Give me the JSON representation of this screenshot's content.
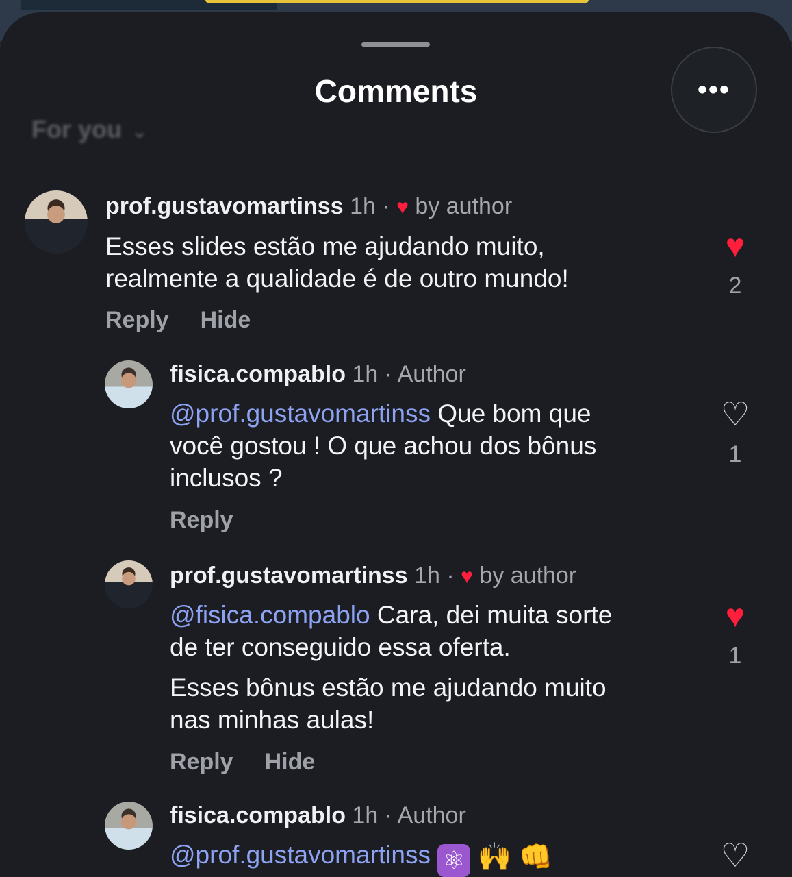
{
  "header": {
    "title": "Comments",
    "more_label": "•••",
    "filter_label": "For you",
    "filter_chevron": "⌄"
  },
  "comments": [
    {
      "username": "prof.gustavomartinss",
      "time": "1h",
      "sep": "·",
      "badge_heart": "♥",
      "badge": "by author",
      "text_lines": [
        "Esses slides estão me ajudando muito,",
        "realmente a qualidade é de outro mundo!"
      ],
      "like_icon": "♥",
      "likes": "2",
      "liked": true,
      "actions": [
        "Reply",
        "Hide"
      ]
    },
    {
      "username": "fisica.compablo",
      "time": "1h",
      "sep": "·",
      "badge": "Author",
      "mention": "@prof.gustavomartinss",
      "text_a": "Que bom que",
      "text_lines": [
        "você gostou ! O que achou dos bônus",
        "inclusos ?"
      ],
      "like_icon": "♡",
      "likes": "1",
      "liked": false,
      "actions": [
        "Reply"
      ]
    },
    {
      "username": "prof.gustavomartinss",
      "time": "1h",
      "sep": "·",
      "badge_heart": "♥",
      "badge": "by author",
      "mention": "@fisica.compablo",
      "text_a": "Cara, dei muita sorte",
      "text_lines": [
        "de ter conseguido essa oferta.",
        "Esses bônus estão me ajudando muito",
        "nas minhas aulas!"
      ],
      "like_icon": "♥",
      "likes": "1",
      "liked": true,
      "actions": [
        "Reply",
        "Hide"
      ]
    },
    {
      "username": "fisica.compablo",
      "time": "1h",
      "sep": "·",
      "badge": "Author",
      "mention": "@prof.gustavomartinss",
      "emoji": [
        "⚛",
        "🙌",
        "👊"
      ],
      "like_icon": "♡",
      "liked": false
    }
  ]
}
